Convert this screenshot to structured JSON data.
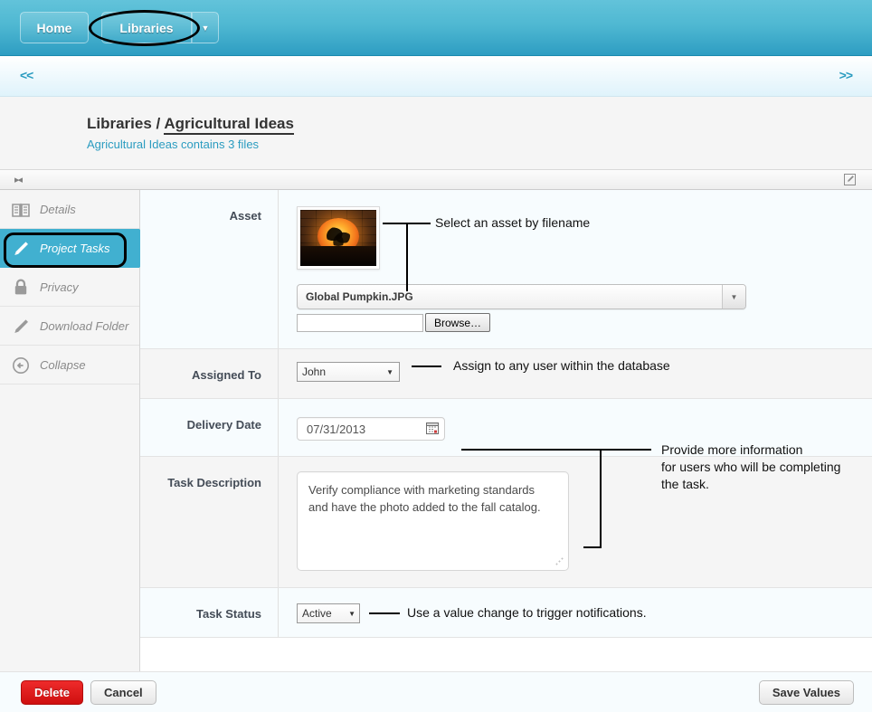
{
  "topnav": {
    "home_label": "Home",
    "libraries_label": "Libraries",
    "caret_glyph": "▼"
  },
  "pager": {
    "prev_label": "<<",
    "next_label": ">>"
  },
  "breadcrumb": {
    "root": "Libraries",
    "separator": "/",
    "current": "Agricultural Ideas",
    "subtitle": "Agricultural Ideas contains 3 files"
  },
  "toolstrip": {
    "collapse_glyph": "▸◂",
    "edit_icon_name": "edit-square-icon"
  },
  "sidebar": {
    "items": [
      {
        "label": "Details",
        "icon": "book-icon",
        "active": false
      },
      {
        "label": "Project Tasks",
        "icon": "pencil-icon",
        "active": true
      },
      {
        "label": "Privacy",
        "icon": "lock-icon",
        "active": false
      },
      {
        "label": "Download Folder",
        "icon": "pencil-icon",
        "active": false
      },
      {
        "label": "Collapse",
        "icon": "back-arrow-circle-icon",
        "active": false
      }
    ]
  },
  "form": {
    "asset": {
      "label": "Asset",
      "thumbnail_alt": "Carved pumpkin with world map glowing against a brick wall",
      "select_value": "Global Pumpkin.JPG",
      "select_arrow": "▼",
      "file_input_value": "",
      "browse_label": "Browse…",
      "annotation": "Select an asset by filename"
    },
    "assigned_to": {
      "label": "Assigned To",
      "value": "John",
      "arrow": "▼",
      "annotation": "Assign to any user within the database"
    },
    "delivery_date": {
      "label": "Delivery Date",
      "value": "07/31/2013",
      "calendar_icon": "calendar-icon"
    },
    "task_description": {
      "label": "Task Description",
      "value": "Verify compliance with marketing standards and have the photo added to the fall catalog."
    },
    "shared_annotation": "Provide more information\nfor users who will be completing\nthe task.",
    "task_status": {
      "label": "Task Status",
      "value": "Active",
      "arrow": "▼",
      "annotation": "Use a value change to trigger notifications."
    }
  },
  "footer": {
    "delete_label": "Delete",
    "cancel_label": "Cancel",
    "save_label": "Save Values"
  },
  "colors": {
    "brand_blue": "#2b9cc0",
    "active_teal": "#41b0d0",
    "delete_red": "#cf0f0f",
    "link_blue": "#2b9cc0"
  }
}
